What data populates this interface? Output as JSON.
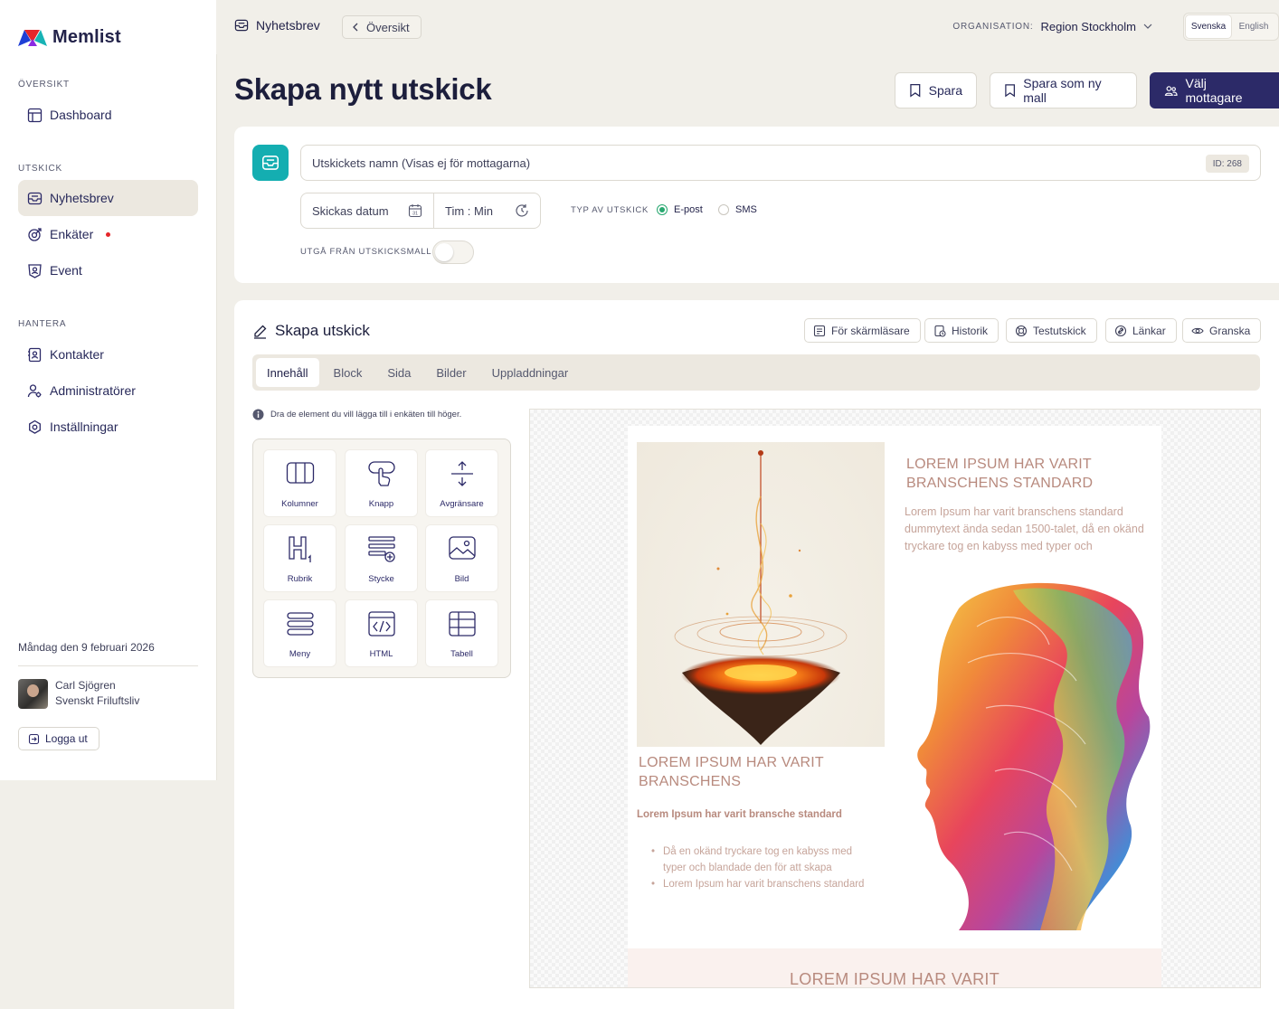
{
  "app": {
    "name": "Memlist"
  },
  "sidebar": {
    "sections": [
      {
        "label": "ÖVERSIKT"
      },
      {
        "label": "UTSKICK"
      },
      {
        "label": "HANTERA"
      }
    ],
    "items": [
      {
        "label": "Dashboard",
        "icon": "dashboard-icon"
      },
      {
        "label": "Nyhetsbrev",
        "icon": "mailbox-icon",
        "active": true
      },
      {
        "label": "Enkäter",
        "icon": "survey-icon",
        "badge": "red-dot"
      },
      {
        "label": "Event",
        "icon": "event-icon"
      },
      {
        "label": "Kontakter",
        "icon": "contacts-icon"
      },
      {
        "label": "Administratörer",
        "icon": "admins-icon"
      },
      {
        "label": "Inställningar",
        "icon": "settings-icon"
      }
    ],
    "date": "Måndag den 9 februari 2026",
    "user": {
      "name": "Carl Sjögren",
      "org": "Svenskt Friluftsliv"
    },
    "logout_label": "Logga ut"
  },
  "topbar": {
    "title": "Nyhetsbrev",
    "back_label": "Översikt",
    "org_label": "ORGANISATION:",
    "org_value": "Region Stockholm",
    "languages": [
      "Svenska",
      "English"
    ],
    "active_language": "Svenska"
  },
  "page": {
    "title": "Skapa nytt utskick",
    "actions": {
      "save": "Spara",
      "save_template": "Spara som ny mall",
      "choose_recipients": "Välj mottagare"
    }
  },
  "form": {
    "name_placeholder": "Utskickets namn  (Visas ej för mottagarna)",
    "id_badge": "ID: 268",
    "date_placeholder": "Skickas datum",
    "time_placeholder": "Tim  :  Min",
    "type_label": "TYP AV UTSKICK",
    "type_options": [
      "E-post",
      "SMS"
    ],
    "type_selected": "E-post",
    "template_label": "UTGÅ FRÅN UTSKICKSMALL",
    "template_toggle": false
  },
  "editor": {
    "title": "Skapa utskick",
    "tools": [
      "För skärmläsare",
      "Historik",
      "Testutskick",
      "Länkar",
      "Granska"
    ],
    "tabs": [
      "Innehåll",
      "Block",
      "Sida",
      "Bilder",
      "Uppladdningar"
    ],
    "active_tab": "Innehåll",
    "hint": "Dra de element du vill lägga till i enkäten till höger.",
    "elements": [
      "Kolumner",
      "Knapp",
      "Avgränsare",
      "Rubrik",
      "Stycke",
      "Bild",
      "Meny",
      "HTML",
      "Tabell"
    ]
  },
  "preview": {
    "heading_right": "LOREM IPSUM HAR VARIT BRANSCHENS STANDARD",
    "para_right": "Lorem Ipsum har varit branschens standard dummytext ända sedan 1500-talet, då en okänd tryckare tog en kabyss med typer och",
    "heading_left": "LOREM IPSUM HAR VARIT BRANSCHENS",
    "bold_left": "Lorem Ipsum har varit bransche standard",
    "list_left": [
      "Då en okänd tryckare tog en kabyss med typer och blandade den för att skapa",
      "Lorem Ipsum har varit branschens standard"
    ],
    "band_heading": "LOREM IPSUM HAR VARIT"
  },
  "colors": {
    "primary": "#2c2a68",
    "accent_teal": "#14aeb1",
    "radio_green": "#28a870",
    "preview_text": "#b88a7e"
  }
}
